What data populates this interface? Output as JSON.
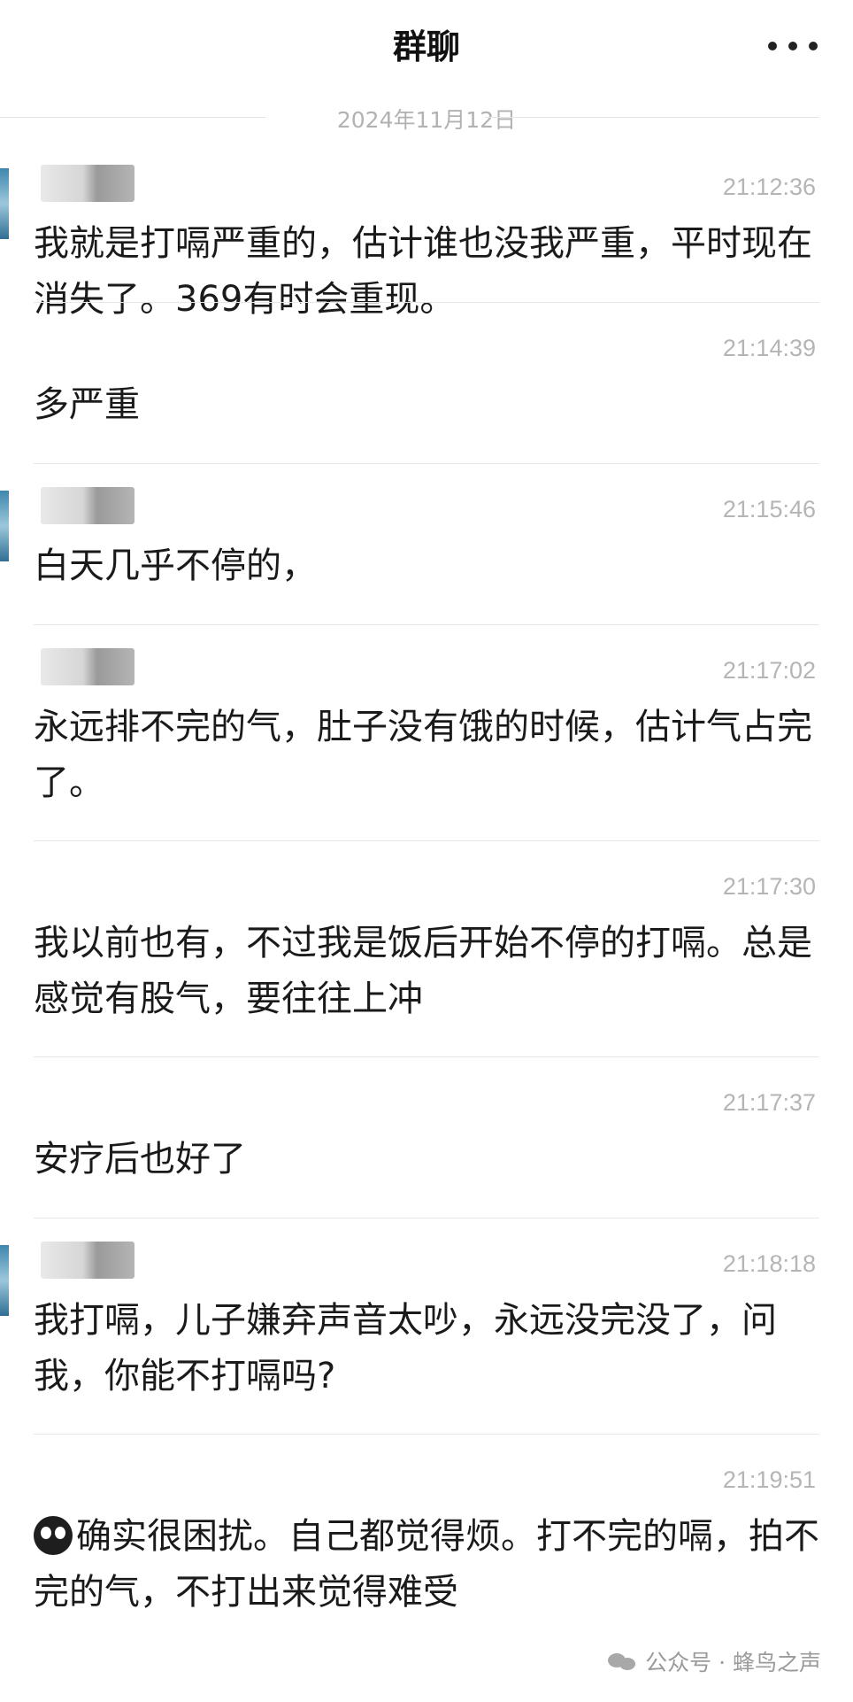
{
  "header": {
    "title": "群聊"
  },
  "date_divider": "2024年11月12日",
  "messages": [
    {
      "time": "21:12:36",
      "text": "我就是打嗝严重的，估计谁也没我严重，平时现在消失了。369有时会重现。",
      "name_blurred": true,
      "avatar": true
    },
    {
      "time": "21:14:39",
      "text": "多严重",
      "name_blurred": false,
      "avatar": false
    },
    {
      "time": "21:15:46",
      "text": "白天几乎不停的，",
      "name_blurred": true,
      "avatar": true
    },
    {
      "time": "21:17:02",
      "text": "永远排不完的气，肚子没有饿的时候，估计气占完了。",
      "name_blurred": true,
      "avatar": false
    },
    {
      "time": "21:17:30",
      "text": "我以前也有，不过我是饭后开始不停的打嗝。总是感觉有股气，要往往上冲",
      "name_blurred": false,
      "avatar": false
    },
    {
      "time": "21:17:37",
      "text": "安疗后也好了",
      "name_blurred": false,
      "avatar": false
    },
    {
      "time": "21:18:18",
      "text": "我打嗝，儿子嫌弃声音太吵，永远没完没了，问我，你能不打嗝吗?",
      "name_blurred": true,
      "avatar": true
    },
    {
      "time": "21:19:51",
      "text": "确实很困扰。自己都觉得烦。打不完的嗝，拍不完的气，不打出来觉得难受",
      "name_blurred": false,
      "avatar": false,
      "emoji": "teary-face"
    }
  ],
  "watermark": "公众号 · 蜂鸟之声",
  "icons": {
    "more": "more-dots-icon",
    "watermark": "wechat-icon"
  }
}
